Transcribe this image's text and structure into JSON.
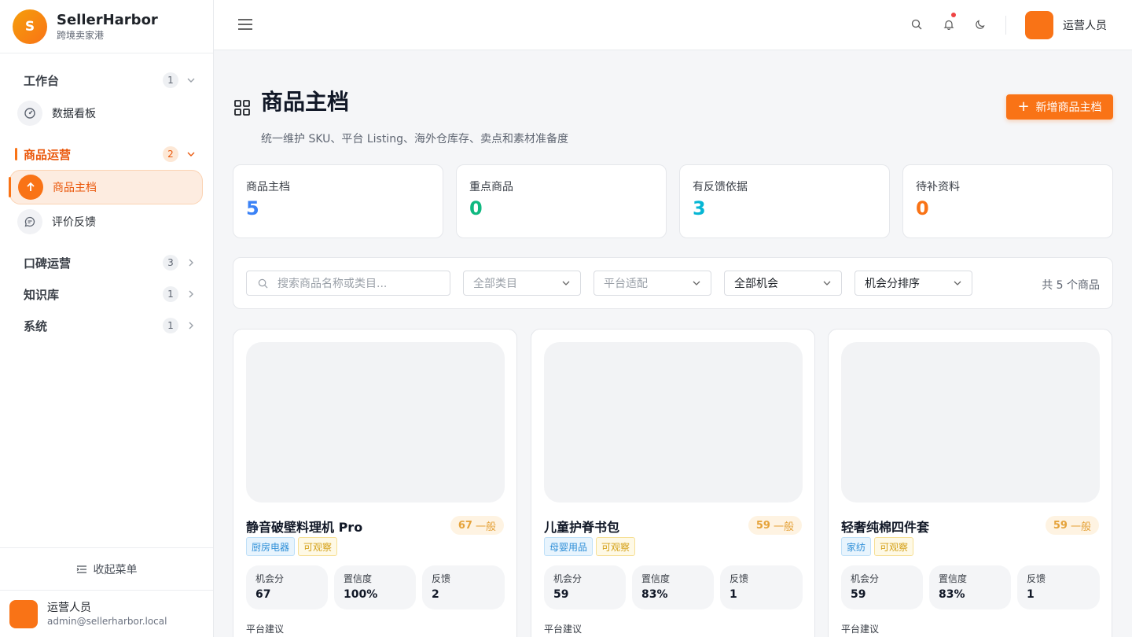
{
  "brand": {
    "logo_letter": "S",
    "name": "SellerHarbor",
    "subtitle": "跨境卖家港"
  },
  "nav": {
    "groups": [
      {
        "label": "工作台",
        "count": "1"
      },
      {
        "label": "商品运营",
        "count": "2"
      },
      {
        "label": "口碑运营",
        "count": "3"
      },
      {
        "label": "知识库",
        "count": "1"
      },
      {
        "label": "系统",
        "count": "1"
      }
    ],
    "items": {
      "dashboard": "数据看板",
      "product_master": "商品主档",
      "reviews": "评价反馈"
    },
    "collapse_label": "收起菜单"
  },
  "user": {
    "name": "运营人员",
    "email": "admin@sellerharbor.local",
    "avatar_glyph": ""
  },
  "page": {
    "title": "商品主档",
    "subtitle": "统一维护 SKU、平台 Listing、海外仓库存、卖点和素材准备度",
    "add_button": "新增商品主档"
  },
  "stats": [
    {
      "label": "商品主档",
      "value": "5",
      "color": "#3b82f6"
    },
    {
      "label": "重点商品",
      "value": "0",
      "color": "#10b981"
    },
    {
      "label": "有反馈依据",
      "value": "3",
      "color": "#06b6d4"
    },
    {
      "label": "待补资料",
      "value": "0",
      "color": "#f97316"
    }
  ],
  "filters": {
    "search_placeholder": "搜索商品名称或类目...",
    "category": "全部类目",
    "platform": "平台适配",
    "opportunity": "全部机会",
    "sort": "机会分排序",
    "count_text": "共 5 个商品"
  },
  "products": [
    {
      "name": "静音破壁料理机 Pro",
      "score": "67",
      "level": "一般",
      "category": "厨房电器",
      "status": "可观察",
      "metrics": [
        {
          "label": "机会分",
          "value": "67"
        },
        {
          "label": "置信度",
          "value": "100%"
        },
        {
          "label": "反馈",
          "value": "2"
        }
      ],
      "section": "平台建议"
    },
    {
      "name": "儿童护脊书包",
      "score": "59",
      "level": "一般",
      "category": "母婴用品",
      "status": "可观察",
      "metrics": [
        {
          "label": "机会分",
          "value": "59"
        },
        {
          "label": "置信度",
          "value": "83%"
        },
        {
          "label": "反馈",
          "value": "1"
        }
      ],
      "section": "平台建议"
    },
    {
      "name": "轻奢纯棉四件套",
      "score": "59",
      "level": "一般",
      "category": "家纺",
      "status": "可观察",
      "metrics": [
        {
          "label": "机会分",
          "value": "59"
        },
        {
          "label": "置信度",
          "value": "83%"
        },
        {
          "label": "反馈",
          "value": "1"
        }
      ],
      "section": "平台建议"
    }
  ]
}
